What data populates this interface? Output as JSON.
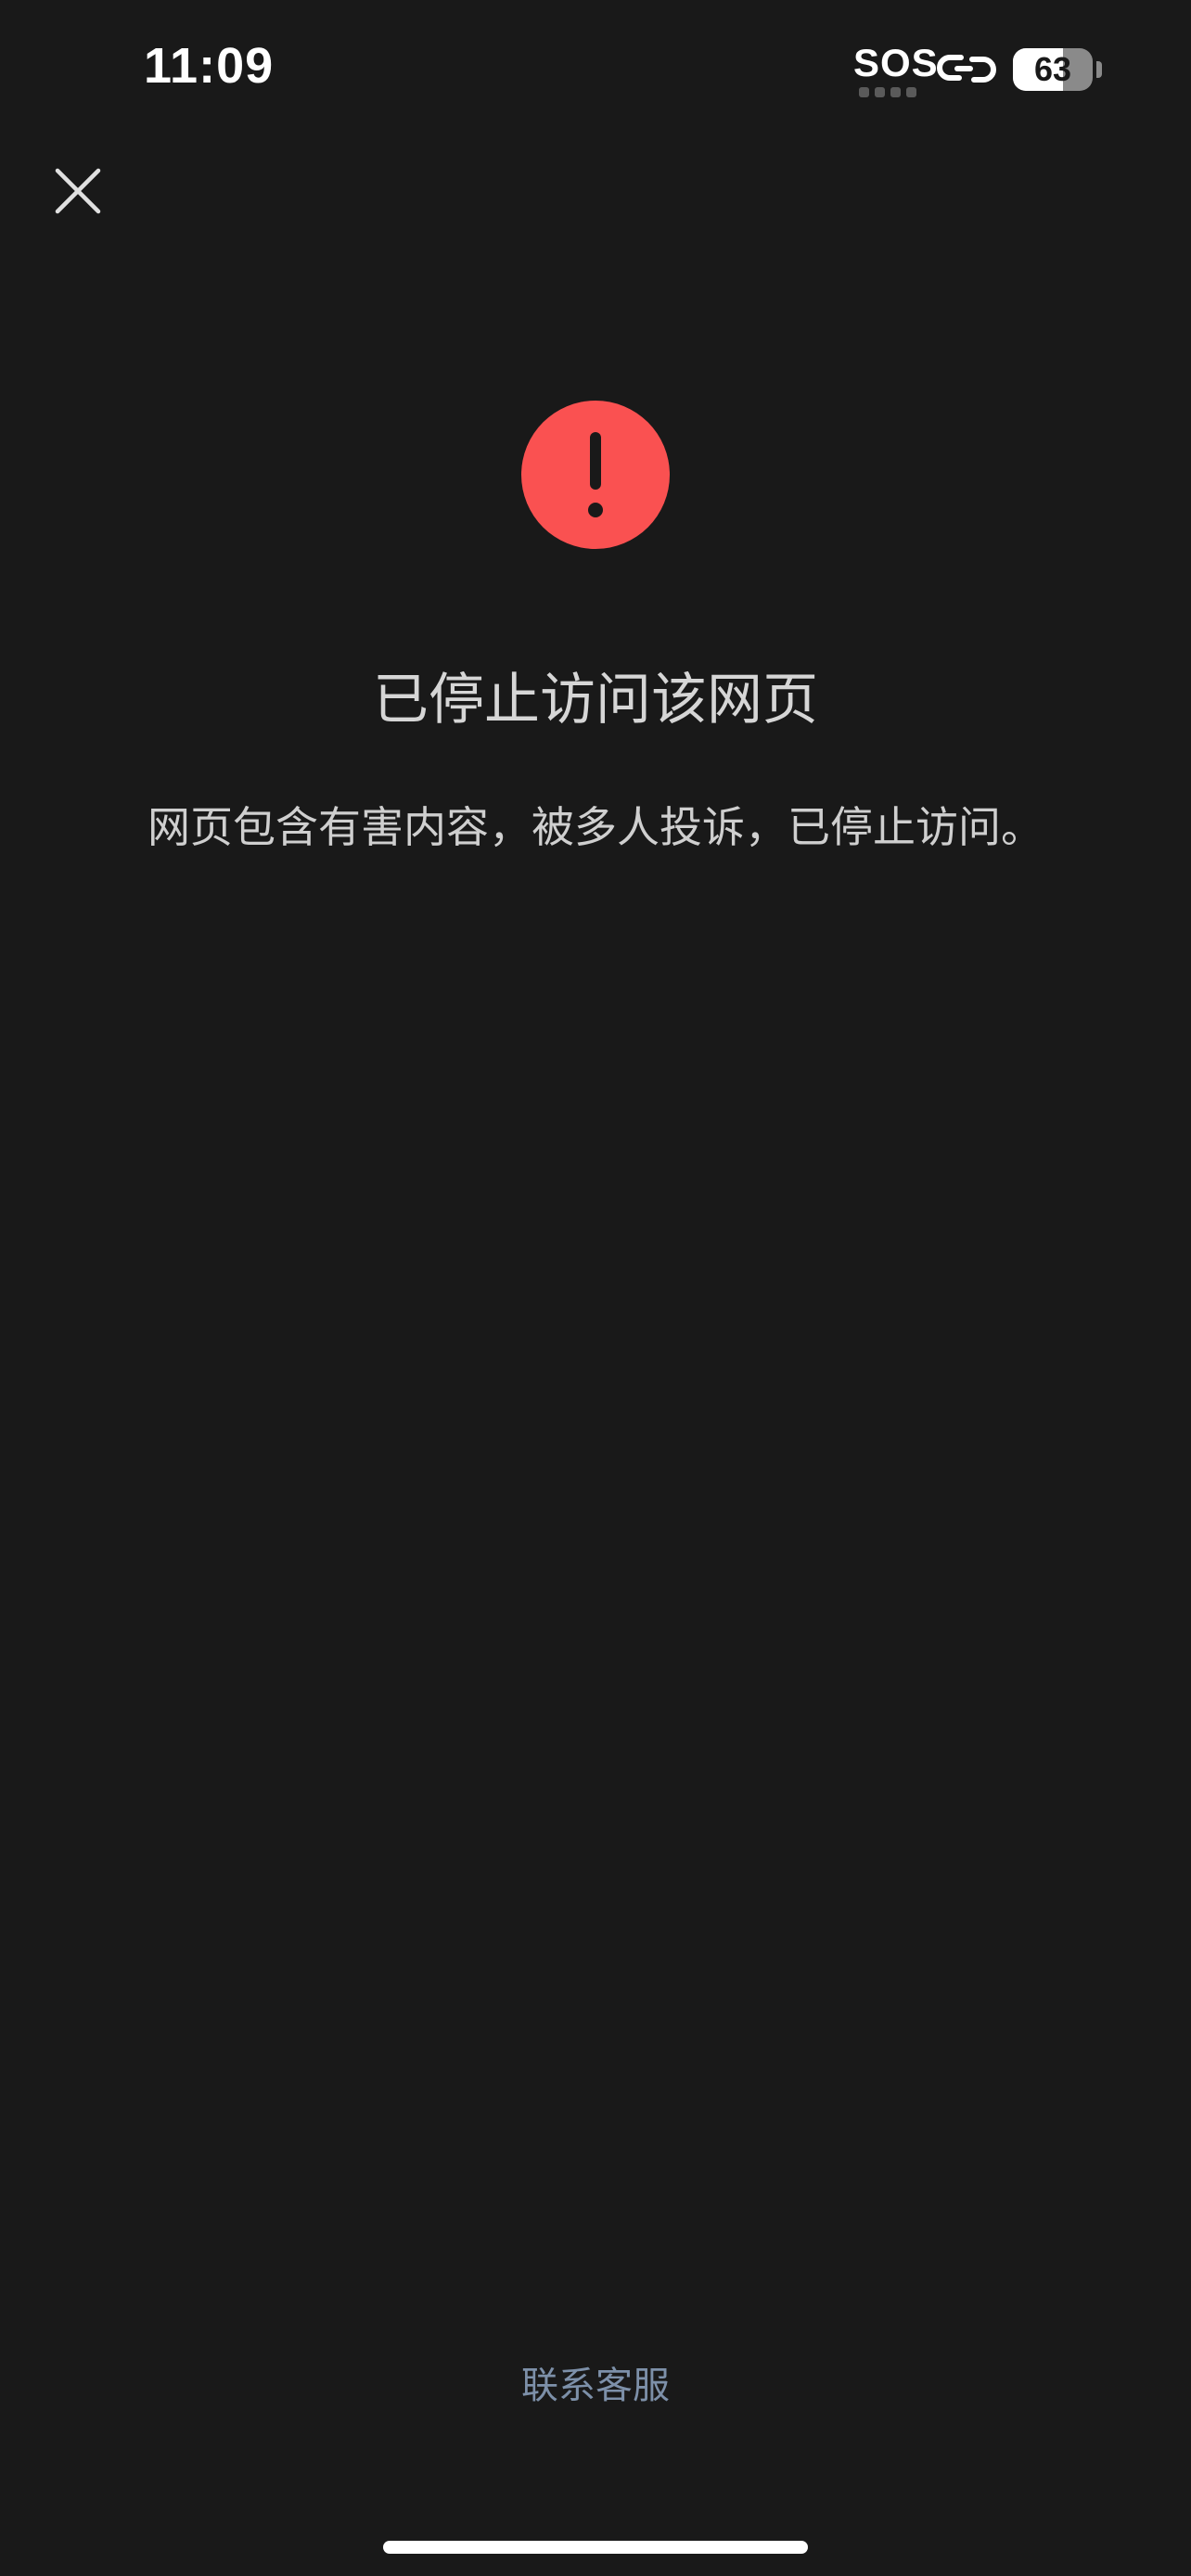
{
  "status_bar": {
    "time": "11:09",
    "sos": "SOS",
    "battery_level": "63",
    "battery_fraction": 0.63,
    "link_icon": "link-icon"
  },
  "header": {
    "close_icon": "close-icon"
  },
  "alert": {
    "icon": "exclamation-icon",
    "color": "#fa5151"
  },
  "main": {
    "title": "已停止访问该网页",
    "message": "网页包含有害内容，被多人投诉，已停止访问。"
  },
  "footer": {
    "contact_label": "联系客服"
  },
  "colors": {
    "background": "#191919",
    "link": "#7d90a9",
    "alert": "#fa5151"
  }
}
